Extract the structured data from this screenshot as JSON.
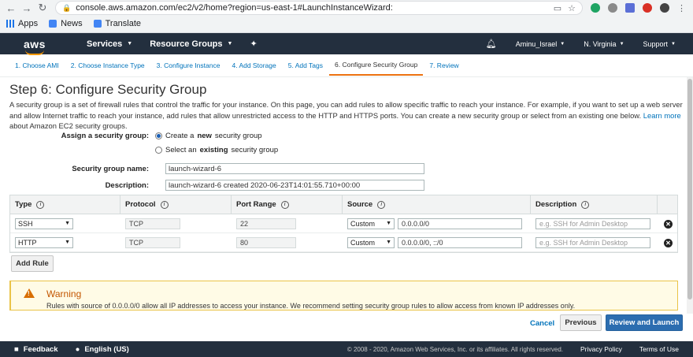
{
  "browser": {
    "url": "console.aws.amazon.com/ec2/v2/home?region=us-east-1#LaunchInstanceWizard:",
    "bookmarks": [
      "Apps",
      "News",
      "Translate"
    ]
  },
  "aws_header": {
    "logo": "aws",
    "services": "Services",
    "resource_groups": "Resource Groups",
    "user": "Aminu_Israel",
    "region": "N. Virginia",
    "support": "Support"
  },
  "wizard_tabs": [
    "1. Choose AMI",
    "2. Choose Instance Type",
    "3. Configure Instance",
    "4. Add Storage",
    "5. Add Tags",
    "6. Configure Security Group",
    "7. Review"
  ],
  "page": {
    "title": "Step 6: Configure Security Group",
    "intro": "A security group is a set of firewall rules that control the traffic for your instance. On this page, you can add rules to allow specific traffic to reach your instance. For example, if you want to set up a web server and allow Internet traffic to reach your instance, add rules that allow unrestricted access to the HTTP and HTTPS ports. You can create a new security group or select from an existing one below.",
    "learn_more": "Learn more",
    "intro_suffix": "about Amazon EC2 security groups."
  },
  "form": {
    "assign_label": "Assign a security group:",
    "option_create_pre": "Create a",
    "option_create_bold": "new",
    "option_create_post": "security group",
    "option_select_pre": "Select an",
    "option_select_bold": "existing",
    "option_select_post": "security group",
    "name_label": "Security group name:",
    "name_value": "launch-wizard-6",
    "desc_label": "Description:",
    "desc_value": "launch-wizard-6 created 2020-06-23T14:01:55.710+00:00"
  },
  "rules_table": {
    "headers": [
      "Type",
      "Protocol",
      "Port Range",
      "Source",
      "Description"
    ],
    "rows": [
      {
        "type": "SSH",
        "protocol": "TCP",
        "port": "22",
        "source_mode": "Custom",
        "source": "0.0.0.0/0",
        "description_placeholder": "e.g. SSH for Admin Desktop"
      },
      {
        "type": "HTTP",
        "protocol": "TCP",
        "port": "80",
        "source_mode": "Custom",
        "source": "0.0.0.0/0, ::/0",
        "description_placeholder": "e.g. SSH for Admin Desktop"
      }
    ]
  },
  "add_rule": "Add Rule",
  "warning": {
    "title": "Warning",
    "text": "Rules with source of 0.0.0.0/0 allow all IP addresses to access your instance. We recommend setting security group rules to allow access from known IP addresses only."
  },
  "actions": {
    "cancel": "Cancel",
    "previous": "Previous",
    "review": "Review and Launch"
  },
  "footer": {
    "feedback": "Feedback",
    "language": "English (US)",
    "copyright": "© 2008 - 2020, Amazon Web Services, Inc. or its affiliates. All rights reserved.",
    "privacy": "Privacy Policy",
    "terms": "Terms of Use"
  },
  "colors": {
    "aws_nav": "#232f3e",
    "accent": "#ec7211",
    "link": "#0073bb",
    "primary_button": "#2c6db0"
  }
}
